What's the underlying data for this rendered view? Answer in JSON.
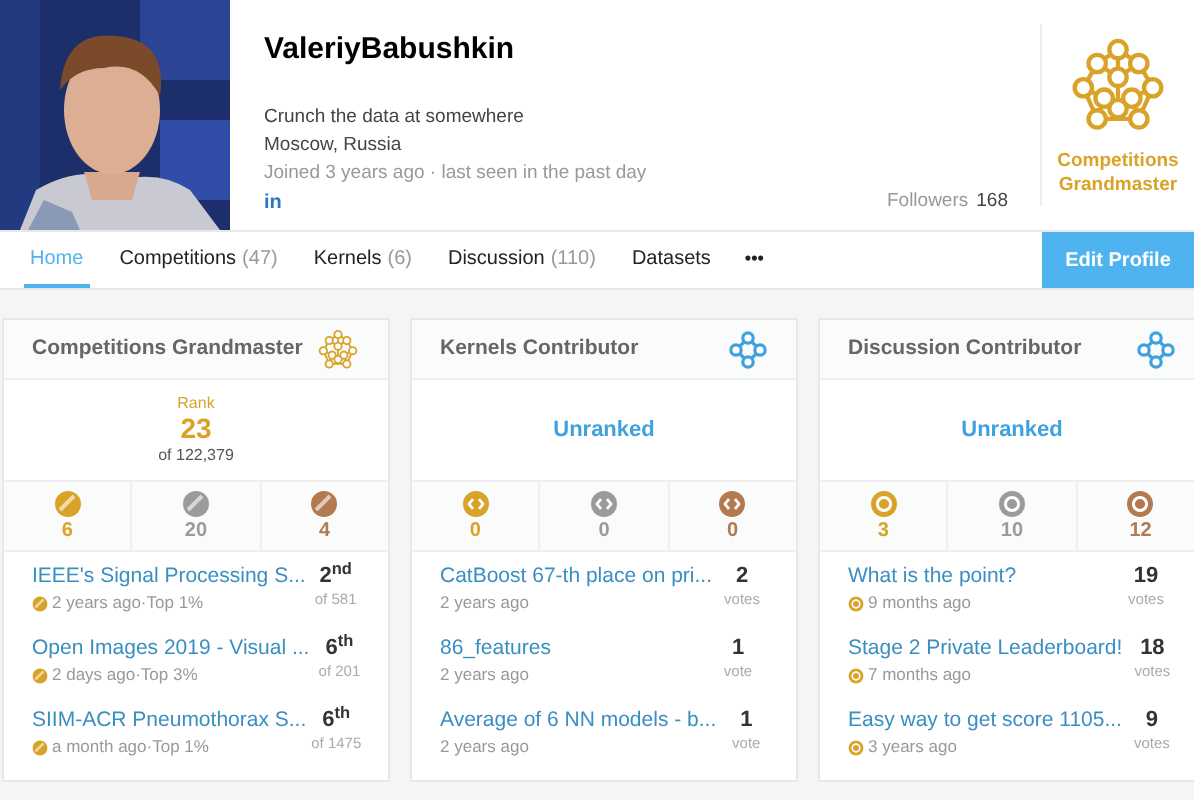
{
  "profile": {
    "name": "ValeriyBabushkin",
    "bio": "Crunch the data at somewhere",
    "location": "Moscow, Russia",
    "joined": "Joined 3 years ago · last seen in the past day",
    "social": "in",
    "followers_label": "Followers",
    "followers_count": "168",
    "tier": "Competitions Grandmaster"
  },
  "tabs": [
    {
      "label": "Home",
      "selected": true
    },
    {
      "label": "Competitions",
      "count": "(47)",
      "selected": false
    },
    {
      "label": "Kernels",
      "count": "(6)",
      "selected": false
    },
    {
      "label": "Discussion",
      "count": "(110)",
      "selected": false
    },
    {
      "label": "Datasets",
      "selected": false
    }
  ],
  "more": "•••",
  "edit_button": "Edit Profile",
  "cards": [
    {
      "kind": "competitions",
      "title": "Competitions Grandmaster",
      "rank_label": "Rank",
      "rank": "23",
      "rank_of": "of 122,379",
      "medals": [
        {
          "count": "6",
          "color": "#d9a32a"
        },
        {
          "count": "20",
          "color": "#9b9b9b"
        },
        {
          "count": "4",
          "color": "#b27a4e"
        }
      ],
      "items": [
        {
          "title": "IEEE's Signal Processing S...",
          "meta": "2 years ago·Top 1%",
          "score": "2$^{nd}$",
          "sub": "of 581"
        },
        {
          "title": "Open Images 2019 - Visual ...",
          "meta": "2 days ago·Top 3%",
          "score": "6$^{th}$",
          "sub": "of 201"
        },
        {
          "title": "SIIM-ACR Pneumothorax S...",
          "meta": "a month ago·Top 1%",
          "score": "6$^{th}$",
          "sub": "of 1475"
        }
      ]
    },
    {
      "kind": "kernels",
      "title": "Kernels Contributor",
      "rank": "Unranked",
      "medals": [
        {
          "count": "0",
          "color": "#d9a32a"
        },
        {
          "count": "0",
          "color": "#9b9b9b"
        },
        {
          "count": "0",
          "color": "#b27a4e"
        }
      ],
      "items": [
        {
          "title": "CatBoost 67-th place on pri...",
          "meta": "2 years ago",
          "score": "2",
          "sub": "votes"
        },
        {
          "title": "86_features",
          "meta": "2 years ago",
          "score": "1",
          "sub": "vote"
        },
        {
          "title": "Average of 6 NN models - b...",
          "meta": "2 years ago",
          "score": "1",
          "sub": "vote"
        }
      ]
    },
    {
      "kind": "discussion",
      "title": "Discussion Contributor",
      "rank": "Unranked",
      "medals": [
        {
          "count": "3",
          "color": "#d9a32a"
        },
        {
          "count": "10",
          "color": "#9b9b9b"
        },
        {
          "count": "12",
          "color": "#b27a4e"
        }
      ],
      "items": [
        {
          "title": "What is the point?",
          "meta": "9 months ago",
          "score": "19",
          "sub": "votes"
        },
        {
          "title": "Stage 2 Private Leaderboard!",
          "meta": "7 months ago",
          "score": "18",
          "sub": "votes"
        },
        {
          "title": "Easy way to get score 1105...",
          "meta": "3 years ago",
          "score": "9",
          "sub": "votes"
        }
      ]
    }
  ]
}
